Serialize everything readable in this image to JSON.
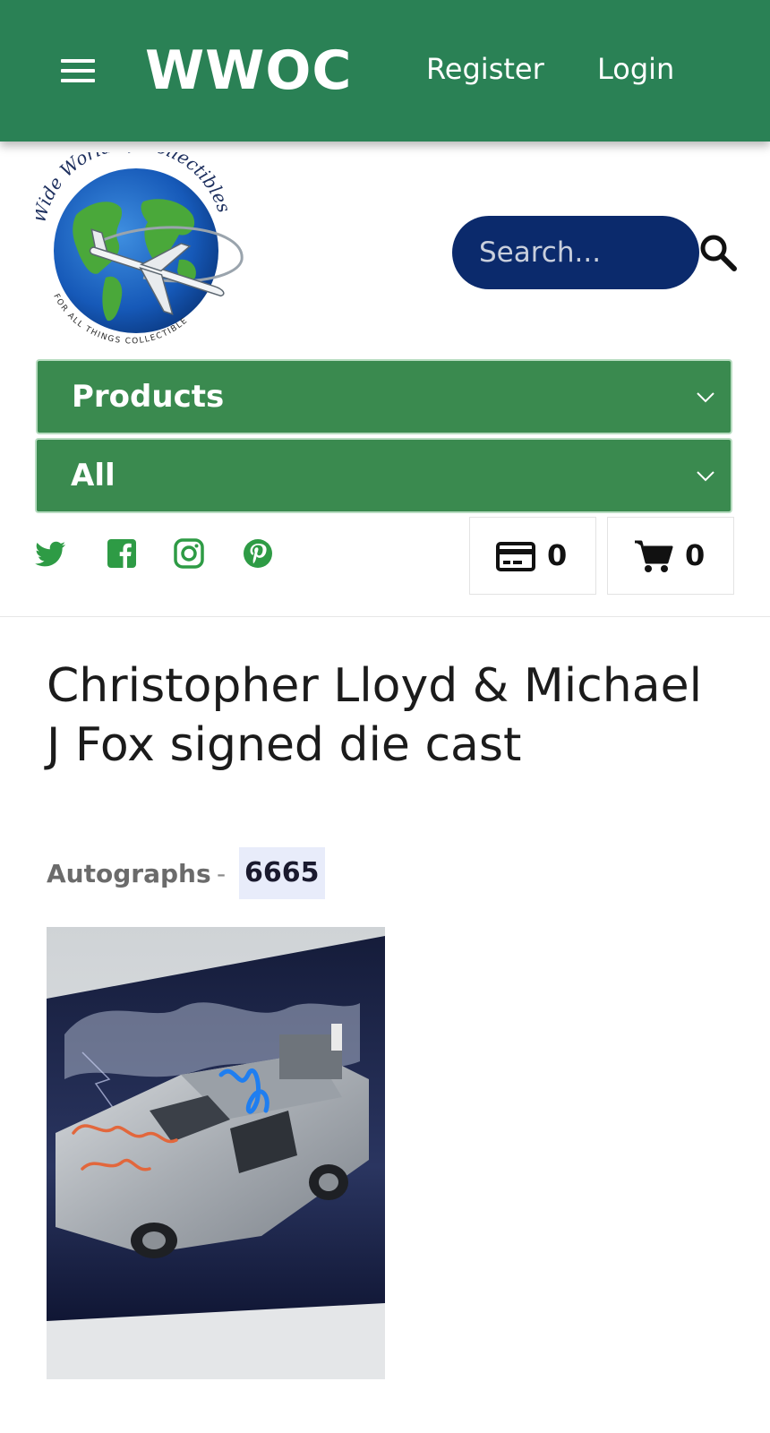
{
  "header": {
    "brand": "WWOC",
    "register_label": "Register",
    "login_label": "Login"
  },
  "logo": {
    "arc_text": "Wide World of Collectibles",
    "tagline": "FOR ALL THINGS COLLECTIBLE"
  },
  "search": {
    "placeholder": "Search..."
  },
  "filters": {
    "products_label": "Products",
    "category_label": "All"
  },
  "social": [
    "twitter-icon",
    "facebook-icon",
    "instagram-icon",
    "pinterest-icon"
  ],
  "counters": {
    "card_count": "0",
    "cart_count": "0"
  },
  "product": {
    "title": "Christopher Lloyd & Michael J Fox signed die cast",
    "category": "Autographs",
    "separator": "-",
    "code": "6665"
  },
  "colors": {
    "header_green": "#2a8155",
    "dropdown_green": "#3a8a4f",
    "search_navy": "#0b2a6c",
    "social_green": "#2e9b45"
  }
}
